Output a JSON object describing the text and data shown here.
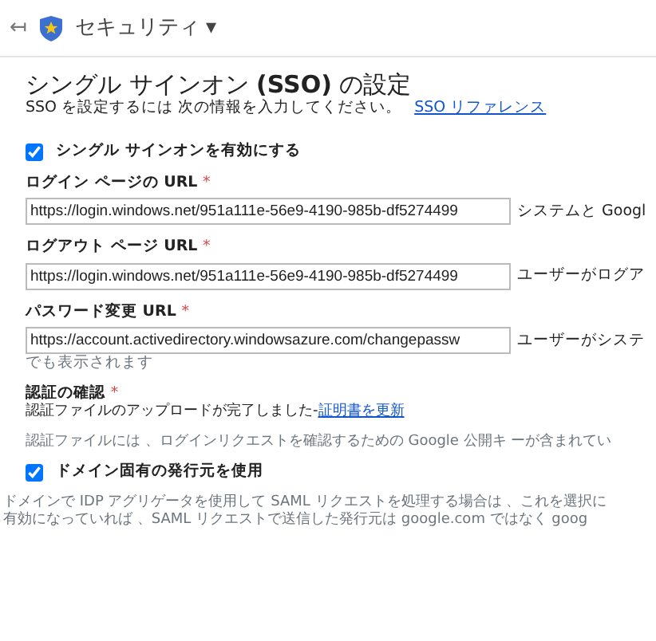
{
  "header": {
    "back": "↤",
    "title": "セキュリティ",
    "caret": "▾"
  },
  "page": {
    "title": "シングル サインオン **(SSO)** の設定",
    "intro": "SSO を設定するには 次の情報を入力してください。",
    "intro_link": "SSO リファレンス"
  },
  "enable_sso": {
    "label": "シングル サインオンを有効にする",
    "checked": true
  },
  "fields": [
    {
      "label": "ログイン ページの URL",
      "required": "*",
      "value": "https://login.windows.net/951a111e-56e9-4190-985b-df5274499",
      "hint": "システムと Googl"
    },
    {
      "label": "ログアウト ページ URL",
      "required": "*",
      "value": "https://login.windows.net/951a111e-56e9-4190-985b-df5274499",
      "hint": "ユーザーがログア"
    },
    {
      "label": "パスワード変更 URL",
      "required": "*",
      "value": "https://account.activedirectory.windowsazure.com/changepassw",
      "hint": "ユーザーがシステ",
      "hint_more": "でも表示されます"
    }
  ],
  "certificate": {
    "label": "認証の確認",
    "required": "*",
    "status": "認証ファイルのアップロードが完了しました-",
    "link": "証明書を更新",
    "note": "認証ファイルには 、ログインリクエストを確認するための Google 公開キ ーが含まれてい"
  },
  "domain_issuer": {
    "label": "ドメイン固有の発行元を使用",
    "checked": true,
    "text": "ドメインで IDP アグリゲータを使用して SAML リクエストを処理する場合は 、これを選択に",
    "text_2": "有効になっていれば 、SAML リクエストで送信した発行元は google.com ではなく goog"
  }
}
